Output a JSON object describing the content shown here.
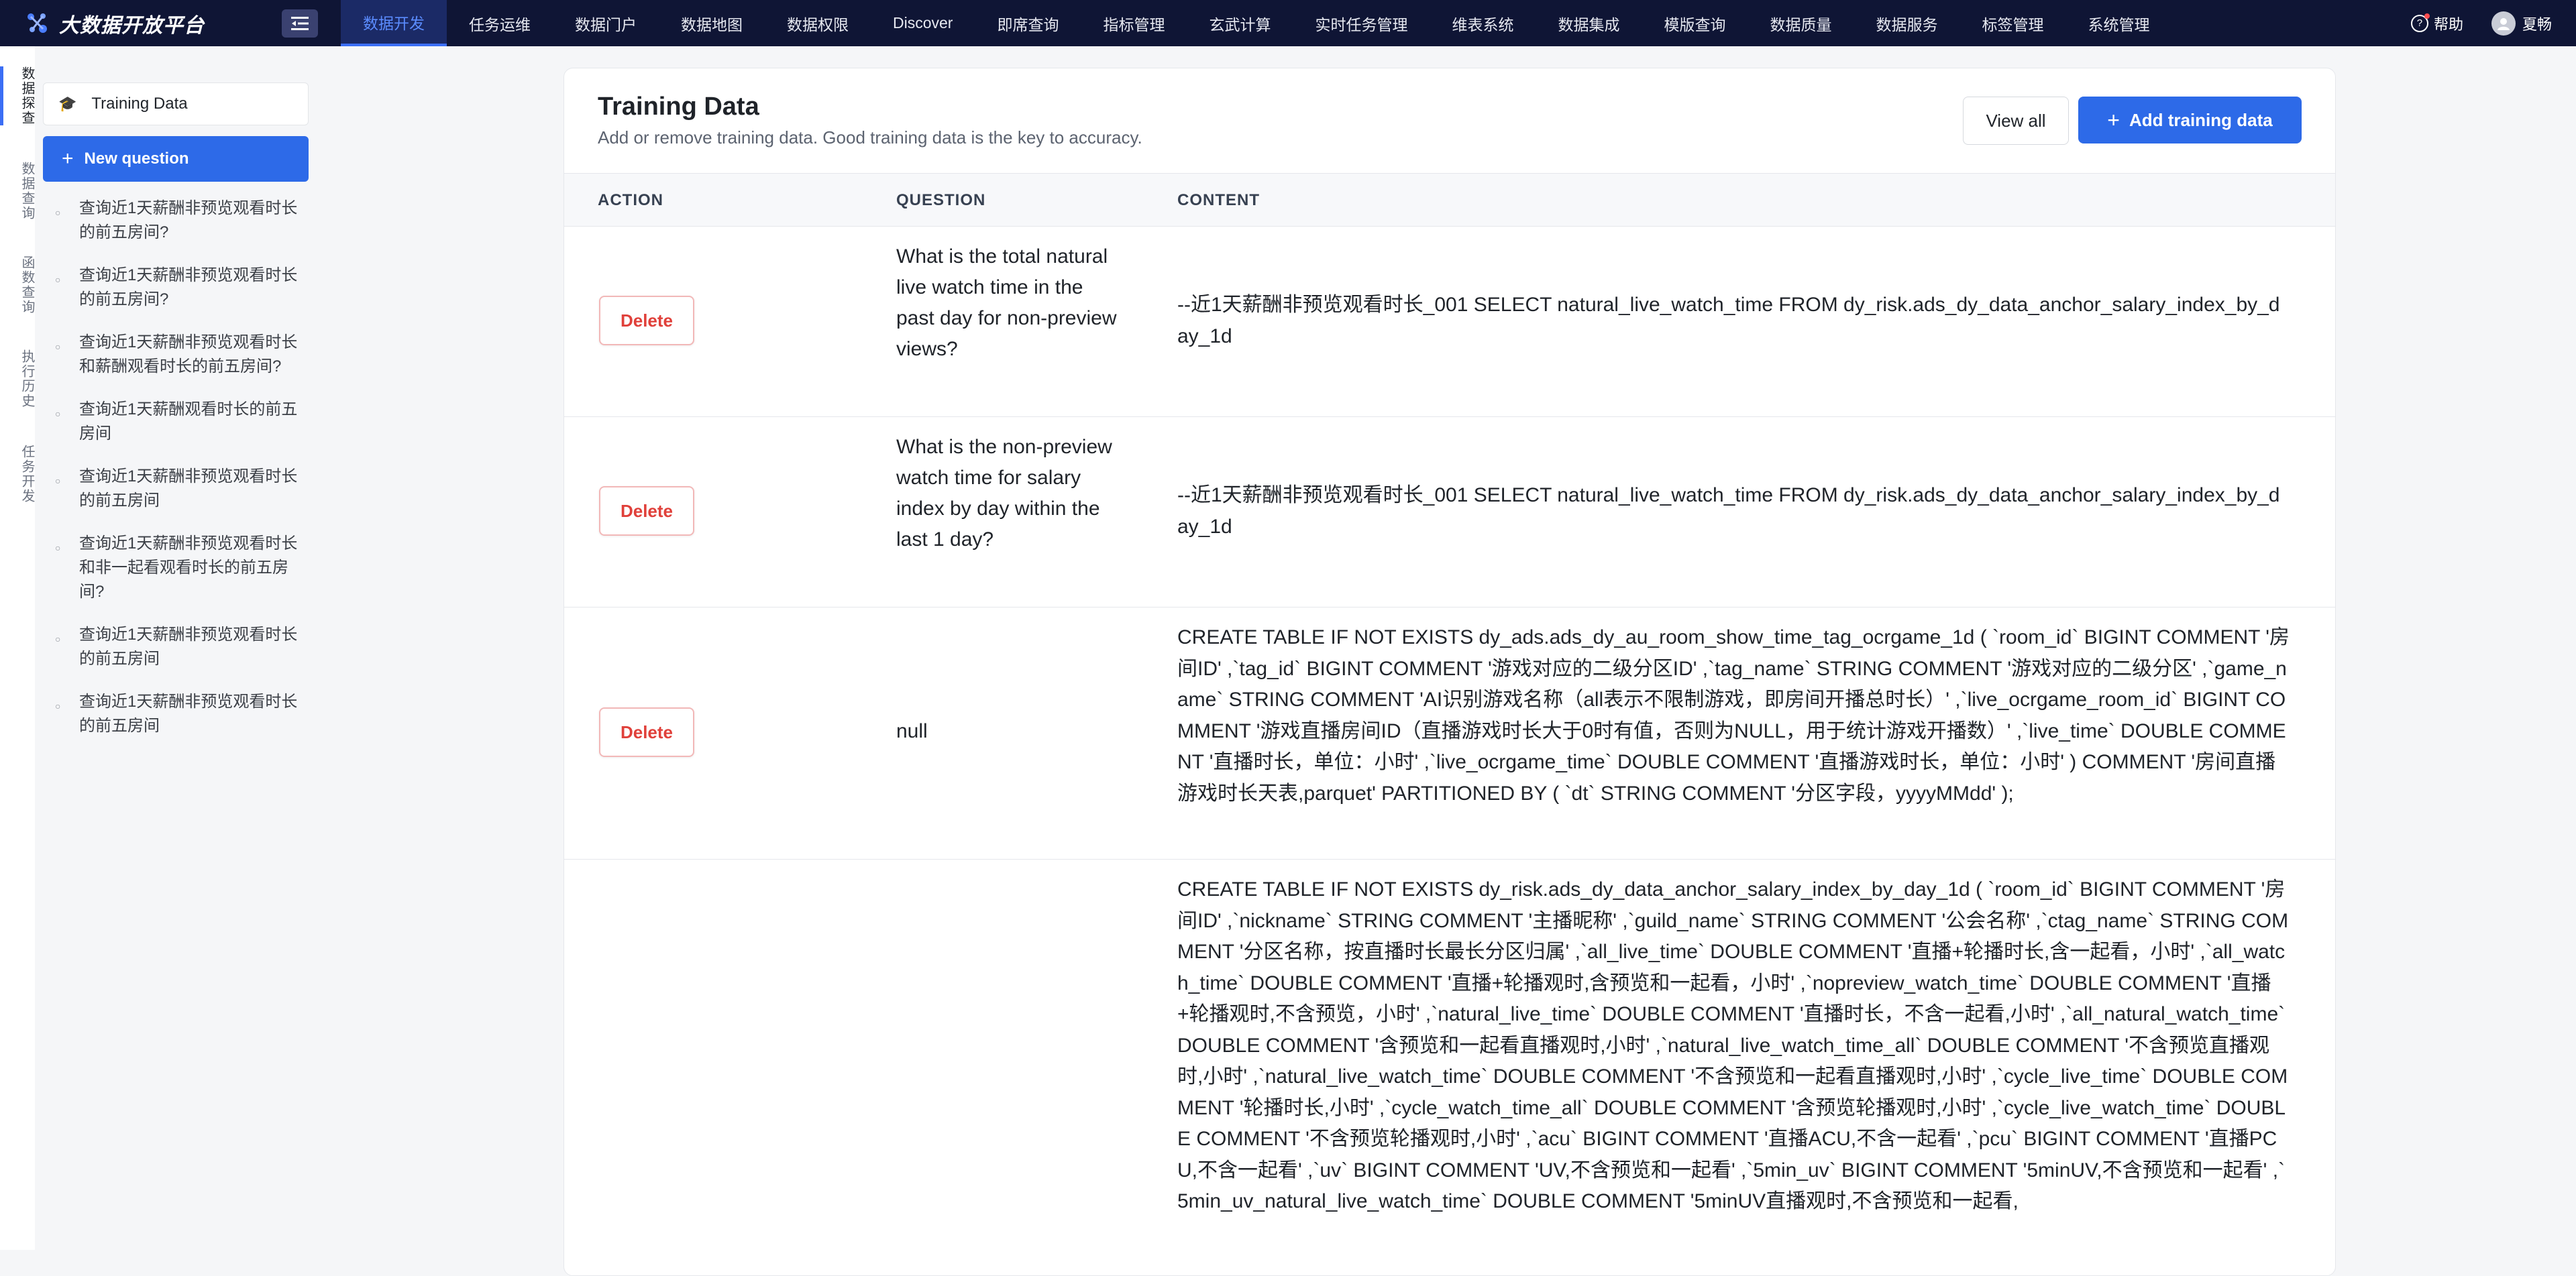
{
  "brand": {
    "name": "大数据开放平台"
  },
  "nav": {
    "items": [
      {
        "label": "数据开发",
        "active": true
      },
      {
        "label": "任务运维"
      },
      {
        "label": "数据门户"
      },
      {
        "label": "数据地图"
      },
      {
        "label": "数据权限"
      },
      {
        "label": "Discover"
      },
      {
        "label": "即席查询"
      },
      {
        "label": "指标管理"
      },
      {
        "label": "玄武计算"
      },
      {
        "label": "实时任务管理"
      },
      {
        "label": "维表系统"
      },
      {
        "label": "数据集成"
      },
      {
        "label": "模版查询"
      },
      {
        "label": "数据质量"
      },
      {
        "label": "数据服务"
      },
      {
        "label": "标签管理"
      },
      {
        "label": "系统管理"
      }
    ],
    "help_label": "帮助",
    "user_name": "夏畅"
  },
  "rail": {
    "items": [
      {
        "label": "数据探查",
        "active": true
      },
      {
        "label": "数据查询"
      },
      {
        "label": "函数查询"
      },
      {
        "label": "执行历史"
      },
      {
        "label": "任务开发"
      }
    ]
  },
  "sidebar": {
    "training_label": "Training Data",
    "new_question_label": "New question",
    "questions": [
      "查询近1天薪酬非预览观看时长的前五房间?",
      "查询近1天薪酬非预览观看时长的前五房间?",
      "查询近1天薪酬非预览观看时长和薪酬观看时长的前五房间?",
      "查询近1天薪酬观看时长的前五房间",
      "查询近1天薪酬非预览观看时长的前五房间",
      "查询近1天薪酬非预览观看时长和非一起看观看时长的前五房间?",
      "查询近1天薪酬非预览观看时长的前五房间",
      "查询近1天薪酬非预览观看时长的前五房间"
    ]
  },
  "main": {
    "title": "Training Data",
    "subtitle": "Add or remove training data. Good training data is the key to accuracy.",
    "view_all_label": "View all",
    "add_label": "Add training data",
    "columns": {
      "action": "ACTION",
      "question": "QUESTION",
      "content": "CONTENT"
    },
    "delete_label": "Delete",
    "rows": [
      {
        "question": "What is the total natural live watch time in the past day for non-preview views?",
        "content": "--近1天薪酬非预览观看时长_001 SELECT natural_live_watch_time FROM dy_risk.ads_dy_data_anchor_salary_index_by_day_1d"
      },
      {
        "question": "What is the non-preview watch time for salary index by day within the last 1 day?",
        "content": "--近1天薪酬非预览观看时长_001 SELECT natural_live_watch_time FROM dy_risk.ads_dy_data_anchor_salary_index_by_day_1d"
      },
      {
        "question": "null",
        "content": "CREATE TABLE IF NOT EXISTS dy_ads.ads_dy_au_room_show_time_tag_ocrgame_1d ( `room_id` BIGINT COMMENT '房间ID' ,`tag_id` BIGINT COMMENT '游戏对应的二级分区ID' ,`tag_name` STRING COMMENT '游戏对应的二级分区' ,`game_name` STRING COMMENT 'AI识别游戏名称（all表示不限制游戏，即房间开播总时长）' ,`live_ocrgame_room_id` BIGINT COMMENT '游戏直播房间ID（直播游戏时长大于0时有值，否则为NULL，用于统计游戏开播数）' ,`live_time` DOUBLE COMMENT '直播时长，单位：小时' ,`live_ocrgame_time` DOUBLE COMMENT '直播游戏时长，单位：小时' ) COMMENT '房间直播游戏时长天表,parquet' PARTITIONED BY ( `dt` STRING COMMENT '分区字段，yyyyMMdd' );"
      },
      {
        "question": "",
        "content": "CREATE TABLE IF NOT EXISTS dy_risk.ads_dy_data_anchor_salary_index_by_day_1d ( `room_id` BIGINT COMMENT '房间ID' ,`nickname` STRING COMMENT '主播昵称' ,`guild_name` STRING COMMENT '公会名称' ,`ctag_name` STRING COMMENT '分区名称，按直播时长最长分区归属' ,`all_live_time` DOUBLE COMMENT '直播+轮播时长,含一起看，小时' ,`all_watch_time` DOUBLE COMMENT '直播+轮播观时,含预览和一起看，小时' ,`nopreview_watch_time` DOUBLE COMMENT '直播+轮播观时,不含预览，小时' ,`natural_live_time` DOUBLE COMMENT '直播时长，不含一起看,小时' ,`all_natural_watch_time` DOUBLE COMMENT '含预览和一起看直播观时,小时' ,`natural_live_watch_time_all` DOUBLE COMMENT '不含预览直播观时,小时' ,`natural_live_watch_time` DOUBLE COMMENT '不含预览和一起看直播观时,小时' ,`cycle_live_time` DOUBLE COMMENT '轮播时长,小时' ,`cycle_watch_time_all` DOUBLE COMMENT '含预览轮播观时,小时' ,`cycle_live_watch_time` DOUBLE COMMENT '不含预览轮播观时,小时' ,`acu` BIGINT COMMENT '直播ACU,不含一起看' ,`pcu` BIGINT COMMENT '直播PCU,不含一起看' ,`uv` BIGINT COMMENT 'UV,不含预览和一起看' ,`5min_uv` BIGINT COMMENT '5minUV,不含预览和一起看' ,`5min_uv_natural_live_watch_time` DOUBLE COMMENT '5minUV直播观时,不含预览和一起看,"
      }
    ]
  }
}
